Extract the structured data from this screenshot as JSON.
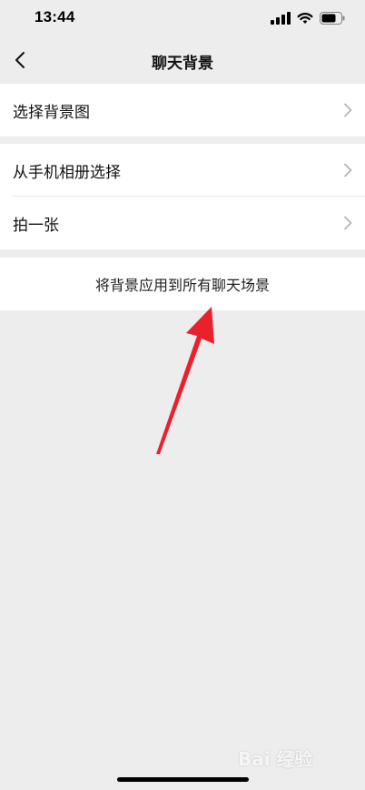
{
  "status_bar": {
    "time": "13:44"
  },
  "nav": {
    "title": "聊天背景"
  },
  "group1": {
    "choose_background": "选择背景图"
  },
  "group2": {
    "from_album": "从手机相册选择",
    "take_photo": "拍一张"
  },
  "group3": {
    "apply_all": "将背景应用到所有聊天场景"
  },
  "annotation": {
    "arrow_color": "#e8212b"
  },
  "watermark": {
    "text": "Bai 经验"
  }
}
